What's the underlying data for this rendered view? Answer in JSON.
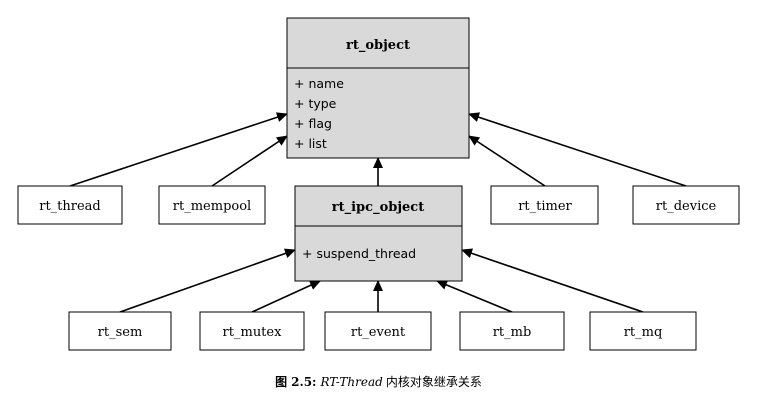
{
  "diagram": {
    "parent": {
      "title": "rt_object",
      "attributes": [
        "+ name",
        "+ type",
        "+ flag",
        "+ list"
      ]
    },
    "ipc": {
      "title": "rt_ipc_object",
      "attributes": [
        "+ suspend_thread"
      ]
    },
    "row1": {
      "thread": "rt_thread",
      "mempool": "rt_mempool",
      "timer": "rt_timer",
      "device": "rt_device"
    },
    "row2": {
      "sem": "rt_sem",
      "mutex": "rt_mutex",
      "event": "rt_event",
      "mb": "rt_mb",
      "mq": "rt_mq"
    }
  },
  "caption": {
    "prefix": "图",
    "number": "2.5:",
    "subject": "RT-Thread",
    "rest": "内核对象继承关系"
  },
  "colors": {
    "class_fill": "#d9d9d9",
    "box_fill": "#ffffff",
    "stroke": "#000000"
  }
}
